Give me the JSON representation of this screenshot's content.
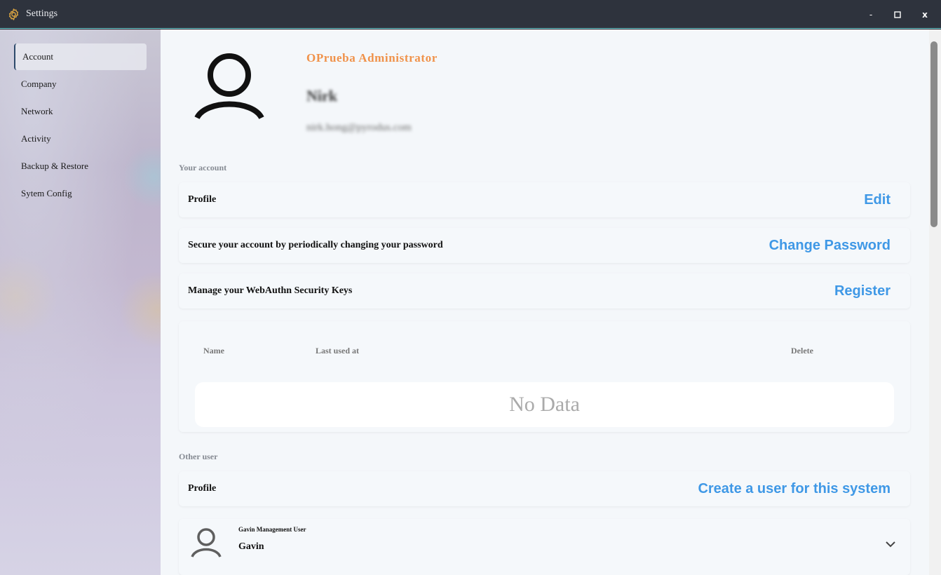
{
  "window": {
    "title": "Settings",
    "minimize": "-",
    "maximize": "□",
    "close": "x"
  },
  "sidebar": {
    "items": [
      {
        "label": "Account",
        "active": true
      },
      {
        "label": "Company"
      },
      {
        "label": "Network"
      },
      {
        "label": "Activity"
      },
      {
        "label": "Backup & Restore"
      },
      {
        "label": "Sytem Config"
      }
    ]
  },
  "profile": {
    "role": "OPrueba Administrator",
    "name": "Nirk",
    "email": "nirk.hong@pyrodus.com"
  },
  "your_account": {
    "section_label": "Your account",
    "profile_label": "Profile",
    "edit_action": "Edit",
    "password_label": "Secure your account by periodically changing your password",
    "password_action": "Change Password",
    "webauthn_label": "Manage your WebAuthn Security Keys",
    "webauthn_action": "Register",
    "keys_table": {
      "columns": [
        "Name",
        "Last used at",
        "Delete"
      ],
      "empty_text": "No Data"
    }
  },
  "other_user": {
    "section_label": "Other user",
    "profile_label": "Profile",
    "create_action": "Create a user for this system",
    "users": [
      {
        "role": "Gavin Management User",
        "name": "Gavin"
      }
    ]
  },
  "colors": {
    "accent_orange": "#f0924a",
    "link_blue": "#3f98e6",
    "titlebar": "#2e333d"
  }
}
